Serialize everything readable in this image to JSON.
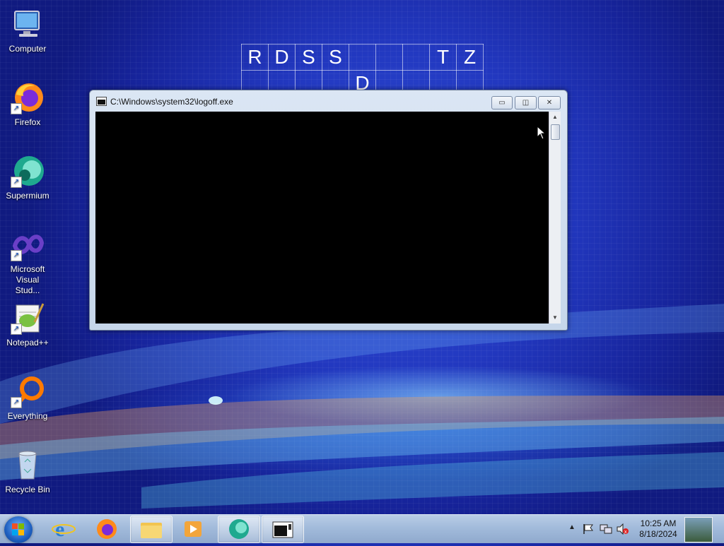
{
  "desktop": {
    "icons": [
      {
        "label": "Computer"
      },
      {
        "label": "Firefox"
      },
      {
        "label": "Supermium"
      },
      {
        "label": "Microsoft Visual Stud..."
      },
      {
        "label": "Notepad++"
      },
      {
        "label": "Everything"
      },
      {
        "label": "Recycle Bin"
      }
    ]
  },
  "crossword": {
    "row1": [
      "R",
      "D",
      "S",
      "S",
      "",
      "",
      "",
      "T",
      "Z"
    ],
    "row2": [
      "",
      "",
      "",
      "",
      "D",
      "",
      "",
      "",
      ""
    ]
  },
  "window": {
    "title": "C:\\Windows\\system32\\logoff.exe",
    "min_label": "▭",
    "max_label": "◫",
    "close_label": "✕"
  },
  "taskbar": {
    "clock_time": "10:25 AM",
    "clock_date": "8/18/2024"
  },
  "colors": {
    "desktop_bg": "#2238c0",
    "console_bg": "#000000",
    "taskbar": "#a2bbdb"
  }
}
